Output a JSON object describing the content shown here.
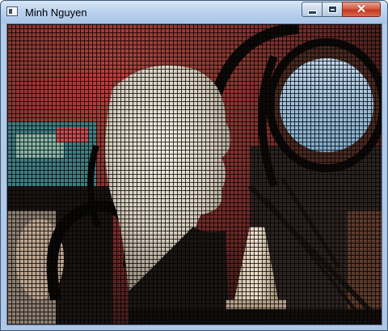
{
  "window": {
    "title": "Minh Nguyen",
    "controls": {
      "minimize": "minimize",
      "maximize": "maximize",
      "close": "close"
    },
    "icon": "app-window-icon"
  },
  "colors": {
    "titlebar": "#bcd3ee",
    "close_button": "#c4371f",
    "frame": "#aec7e4"
  }
}
